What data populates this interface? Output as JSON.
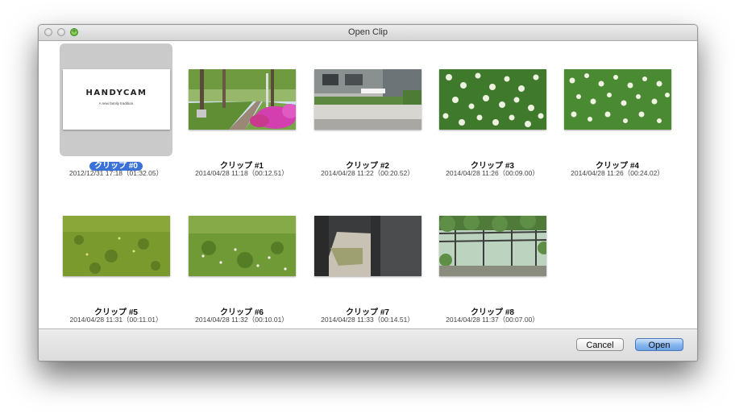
{
  "window": {
    "title": "Open Clip"
  },
  "clips": [
    {
      "name": "クリップ #0",
      "meta": "2012/12/31 17:18（01:32.05）",
      "selected": true,
      "thumb": "handycam-logo"
    },
    {
      "name": "クリップ #1",
      "meta": "2014/04/28 11:18（00:12.51）",
      "selected": false,
      "thumb": "street-trees-azaleas"
    },
    {
      "name": "クリップ #2",
      "meta": "2014/04/28 11:22（00:20.52）",
      "selected": false,
      "thumb": "building-planter"
    },
    {
      "name": "クリップ #3",
      "meta": "2014/04/28 11:26（00:09.00）",
      "selected": false,
      "thumb": "clover-field"
    },
    {
      "name": "クリップ #4",
      "meta": "2014/04/28 11:26（00:24.02）",
      "selected": false,
      "thumb": "clover-field"
    },
    {
      "name": "クリップ #5",
      "meta": "2014/04/28 11:31（00:11.01）",
      "selected": false,
      "thumb": "grass-field"
    },
    {
      "name": "クリップ #6",
      "meta": "2014/04/28 11:32（00:10.01）",
      "selected": false,
      "thumb": "grass-flowers"
    },
    {
      "name": "クリップ #7",
      "meta": "2014/04/28 11:33（00:14.51）",
      "selected": false,
      "thumb": "underpass-path"
    },
    {
      "name": "クリップ #8",
      "meta": "2014/04/28 11:37（00:07.00）",
      "selected": false,
      "thumb": "pergola-garden"
    }
  ],
  "handycam": {
    "logo": "HANDYCAM",
    "tagline": "A new family tradition."
  },
  "buttons": {
    "cancel": "Cancel",
    "open": "Open"
  },
  "colors": {
    "selection": "#3a72d9",
    "default_button": "#86b5ee"
  }
}
